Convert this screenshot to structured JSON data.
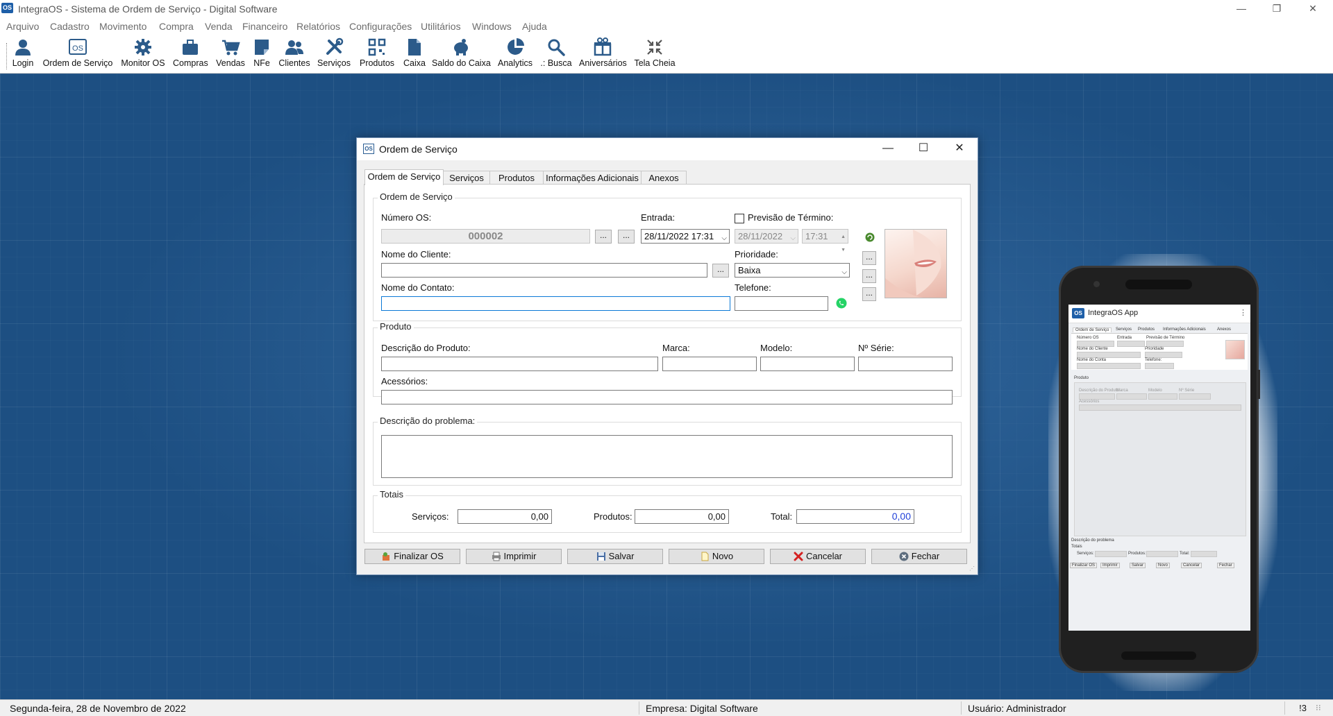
{
  "window": {
    "app_icon_text": "OS",
    "title": "IntegraOS - Sistema de Ordem de Serviço - Digital Software",
    "minimize": "—",
    "restore": "❐",
    "close": "✕"
  },
  "menu": [
    "Arquivo",
    "Cadastro",
    "Movimento",
    "Compra",
    "Venda",
    "Financeiro",
    "Relatórios",
    "Configurações",
    "Utilitários",
    "Windows",
    "Ajuda"
  ],
  "toolbar": [
    {
      "label": "Login",
      "icon": "user-icon"
    },
    {
      "label": "Ordem de Serviço",
      "icon": "os-icon"
    },
    {
      "label": "Monitor OS",
      "icon": "gear-icon"
    },
    {
      "label": "Compras",
      "icon": "briefcase-icon"
    },
    {
      "label": "Vendas",
      "icon": "cart-icon"
    },
    {
      "label": "NFe",
      "icon": "nfe-icon"
    },
    {
      "label": "Clientes",
      "icon": "users-icon"
    },
    {
      "label": "Serviços",
      "icon": "tools-icon"
    },
    {
      "label": "Produtos",
      "icon": "qrcode-icon"
    },
    {
      "label": "Caixa",
      "icon": "document-icon"
    },
    {
      "label": "Saldo do Caixa",
      "icon": "piggy-bank-icon"
    },
    {
      "label": "Analytics",
      "icon": "pie-chart-icon"
    },
    {
      "label": ".: Busca",
      "icon": "search-icon"
    },
    {
      "label": "Aniversários",
      "icon": "gift-icon"
    },
    {
      "label": "Tela Cheia",
      "icon": "fullscreen-icon"
    }
  ],
  "colors": {
    "accent": "#2a6fb0",
    "toolbar_icon": "#2c5b8a",
    "background": "#1d4f82"
  },
  "dialog": {
    "title": "Ordem de Serviço",
    "icon_text": "OS",
    "tabs": [
      "Ordem de Serviço",
      "Serviços",
      "Produtos",
      "Informações Adicionais",
      "Anexos"
    ],
    "active_tab": "Ordem de Serviço",
    "group_os": {
      "label": "Ordem de Serviço",
      "numero_label": "Número OS:",
      "numero_value": "000002",
      "entrada_label": "Entrada:",
      "entrada_value": "28/11/2022 17:31",
      "previsao_label": "Previsão de Término:",
      "previsao_checked": false,
      "previsao_date": "28/11/2022",
      "previsao_time": "17:31",
      "cliente_label": "Nome do Cliente:",
      "cliente_value": "",
      "prioridade_label": "Prioridade:",
      "prioridade_value": "Baixa",
      "contato_label": "Nome do Contato:",
      "contato_value": "",
      "telefone_label": "Telefone:",
      "telefone_value": "",
      "dots": "..."
    },
    "group_produto": {
      "label": "Produto",
      "descricao_label": "Descrição do Produto:",
      "marca_label": "Marca:",
      "modelo_label": "Modelo:",
      "serie_label": "Nº Série:",
      "acessorios_label": "Acessórios:"
    },
    "group_problema": {
      "label": "Descrição do problema:"
    },
    "group_totais": {
      "label": "Totais",
      "servicos_label": "Serviços:",
      "servicos_value": "0,00",
      "produtos_label": "Produtos:",
      "produtos_value": "0,00",
      "total_label": "Total:",
      "total_value": "0,00"
    },
    "buttons": [
      "Finalizar OS",
      "Imprimir",
      "Salvar",
      "Novo",
      "Cancelar",
      "Fechar"
    ]
  },
  "phone": {
    "app_title": "IntegraOS App",
    "app_icon_text": "OS",
    "tabs": [
      "Ordem de Serviço",
      "Serviços",
      "Produtos",
      "Informações Adicionais",
      "Anexos"
    ],
    "labels": {
      "numero": "Número OS",
      "entrada": "Entrada",
      "previsao": "Previsão de Término",
      "cliente": "Nome do Cliente",
      "prioridade": "Prioridade",
      "contato": "Nome do Conta",
      "telefone": "Telefone:",
      "produto": "Produto",
      "descricao_produto": "Descrição do Produto",
      "marca": "Marca",
      "modelo": "Modelo",
      "serie": "Nº Série",
      "acessorios": "Acessórios",
      "problema": "Descrição do problema",
      "totais": "Totais",
      "servicos": "Serviços:",
      "produtos": "Produtos:",
      "total": "Total:"
    },
    "buttons": [
      "Finalizar OS",
      "Imprimir",
      "Salvar",
      "Novo",
      "Cancelar",
      "Fechar"
    ]
  },
  "status": {
    "date": "Segunda-feira, 28 de Novembro de 2022",
    "empresa": "Empresa: Digital Software",
    "usuario": "Usuário: Administrador",
    "indicator": " !3",
    "indicator_suffix": "⁝⁝"
  }
}
